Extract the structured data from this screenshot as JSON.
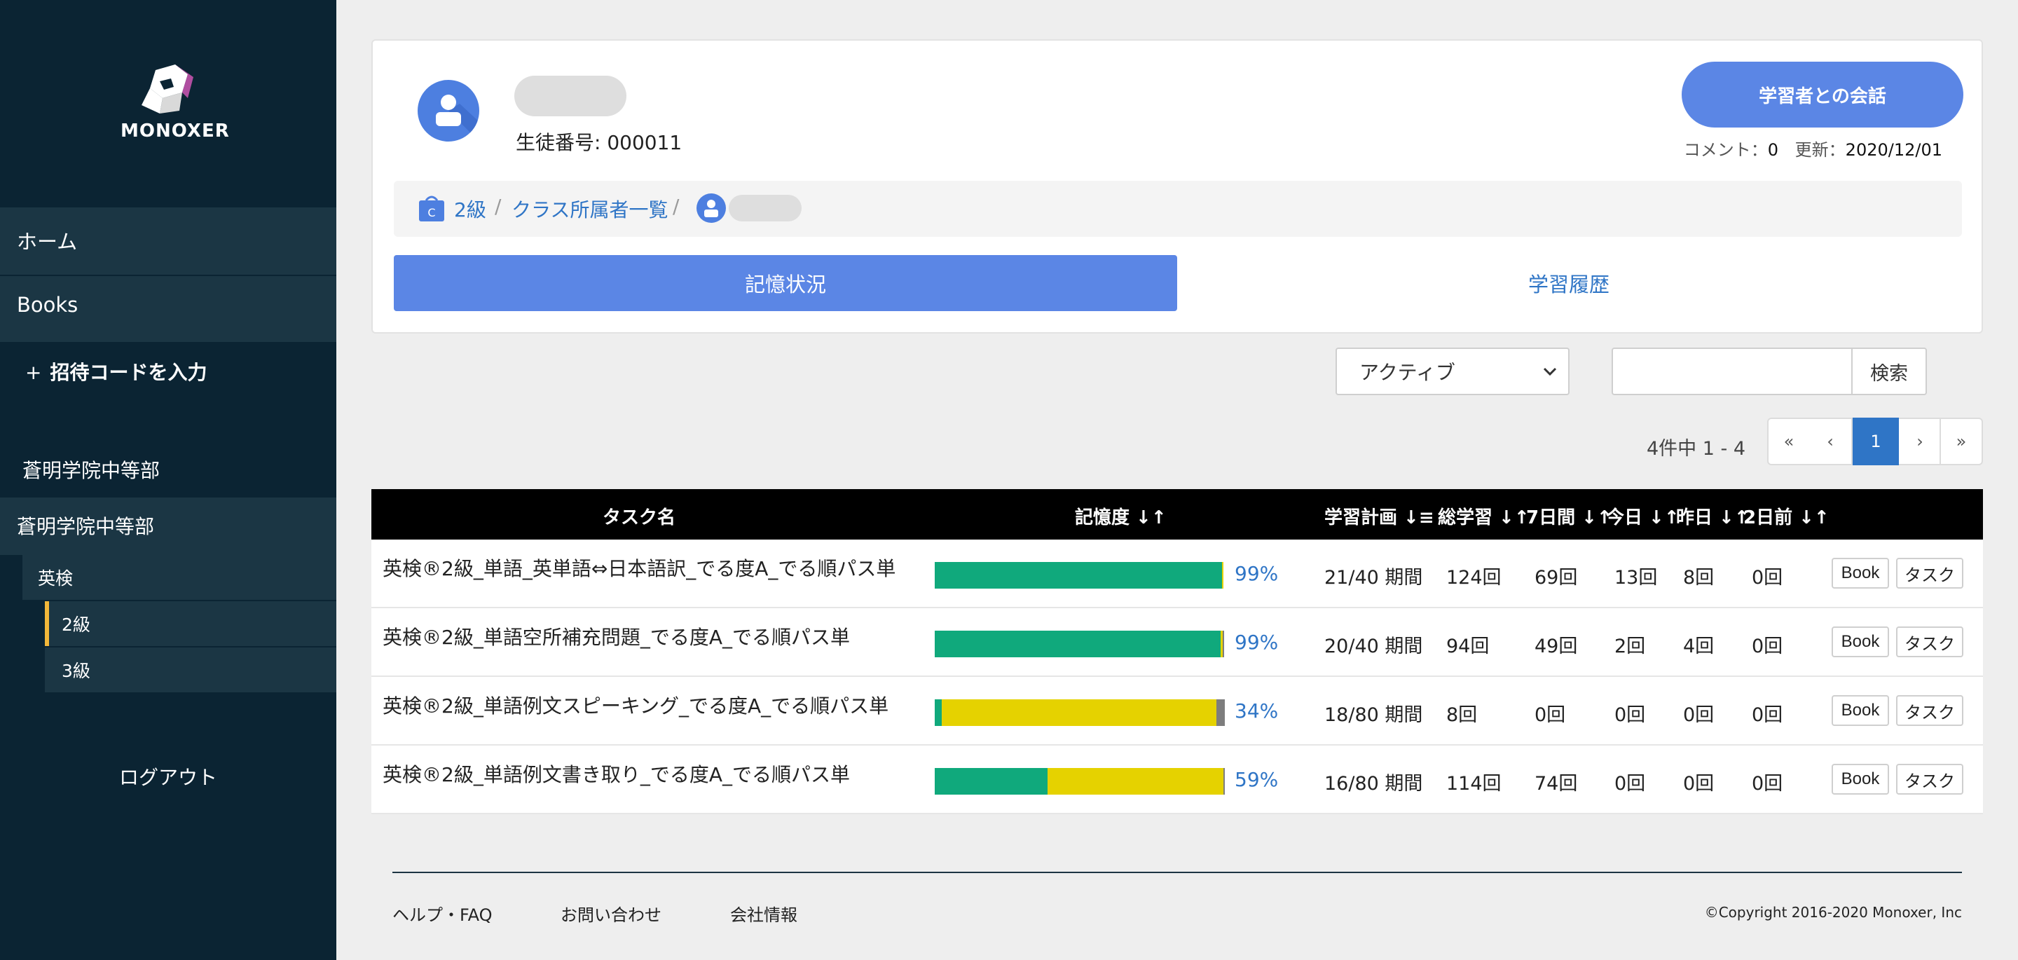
{
  "app": {
    "logo_text": "MONOXER"
  },
  "sidebar": {
    "nav": [
      {
        "label": "ホーム"
      },
      {
        "label": "Books"
      }
    ],
    "invite": {
      "plus": "+",
      "label": "招待コードを入力"
    },
    "schools": [
      {
        "label": "蒼明学院中等部"
      },
      {
        "label": "蒼明学院中等部"
      }
    ],
    "subitems": [
      {
        "label": "英検"
      },
      {
        "label": "2級"
      },
      {
        "label": "3級"
      }
    ],
    "logout_label": "ログアウト"
  },
  "profile": {
    "student_no": "生徒番号: 000011",
    "chat_button": "学習者との会話",
    "comment_label": "コメント：",
    "comment_count": "0",
    "update_label": "更新：",
    "update_date": "2020/12/01"
  },
  "breadcrumb": {
    "class": "2級",
    "members": "クラス所属者一覧",
    "sep": "/"
  },
  "tabs": [
    {
      "label": "記憶状況"
    },
    {
      "label": "学習履歴"
    }
  ],
  "filters": {
    "status_selected": "アクティブ",
    "search_value": "",
    "search_button": "検索"
  },
  "pagination": {
    "count_text": "4件中 1 - 4",
    "first": "«",
    "prev": "‹",
    "current": "1",
    "next": "›",
    "last": "»"
  },
  "table": {
    "headers": {
      "task": "タスク名",
      "memory": "記憶度 ↓↑",
      "plan": "学習計画 ↓≡",
      "total": "総学習 ↓↑",
      "week": "7日間 ↓↑",
      "today": "今日 ↓↑",
      "yesterday": "昨日 ↓↑",
      "two_days": "2日前 ↓↑"
    },
    "rows": [
      {
        "task": "英検®2級_単語_英単語⇔日本語訳_でる度A_でる順パス単",
        "memory_pct": "99%",
        "green": 0.99,
        "yellow": 0.005,
        "gray": 0,
        "plan": "21/40 期間",
        "total": "124回",
        "week": "69回",
        "today": "13回",
        "yesterday": "8回",
        "two_days": "0回",
        "book_button": "Book",
        "task_button": "タスク"
      },
      {
        "task": "英検®2級_単語空所補充問題_でる度A_でる順パス単",
        "memory_pct": "99%",
        "green": 0.985,
        "yellow": 0.008,
        "gray": 0.004,
        "plan": "20/40 期間",
        "total": "94回",
        "week": "49回",
        "today": "2回",
        "yesterday": "4回",
        "two_days": "0回",
        "book_button": "Book",
        "task_button": "タスク"
      },
      {
        "task": "英検®2級_単語例文スピーキング_でる度A_でる順パス単",
        "memory_pct": "34%",
        "green": 0.025,
        "yellow": 0.945,
        "gray": 0.03,
        "plan": "18/80 期間",
        "total": "8回",
        "week": "0回",
        "today": "0回",
        "yesterday": "0回",
        "two_days": "0回",
        "book_button": "Book",
        "task_button": "タスク"
      },
      {
        "task": "英検®2級_単語例文書き取り_でる度A_でる順パス単",
        "memory_pct": "59%",
        "green": 0.39,
        "yellow": 0.605,
        "gray": 0.005,
        "plan": "16/80 期間",
        "total": "114回",
        "week": "74回",
        "today": "0回",
        "yesterday": "0回",
        "two_days": "0回",
        "book_button": "Book",
        "task_button": "タスク"
      }
    ]
  },
  "footer": {
    "help": "ヘルプ・FAQ",
    "contact": "お問い合わせ",
    "company": "会社情報",
    "copyright": "©Copyright 2016-2020 Monoxer, Inc"
  },
  "colors": {
    "accent": "#5b86e5",
    "link": "#2f75c6",
    "sidebar": "#0b2433",
    "bar_green": "#10a97c",
    "bar_yellow": "#e5d200",
    "bar_gray": "#7d7d7d"
  }
}
